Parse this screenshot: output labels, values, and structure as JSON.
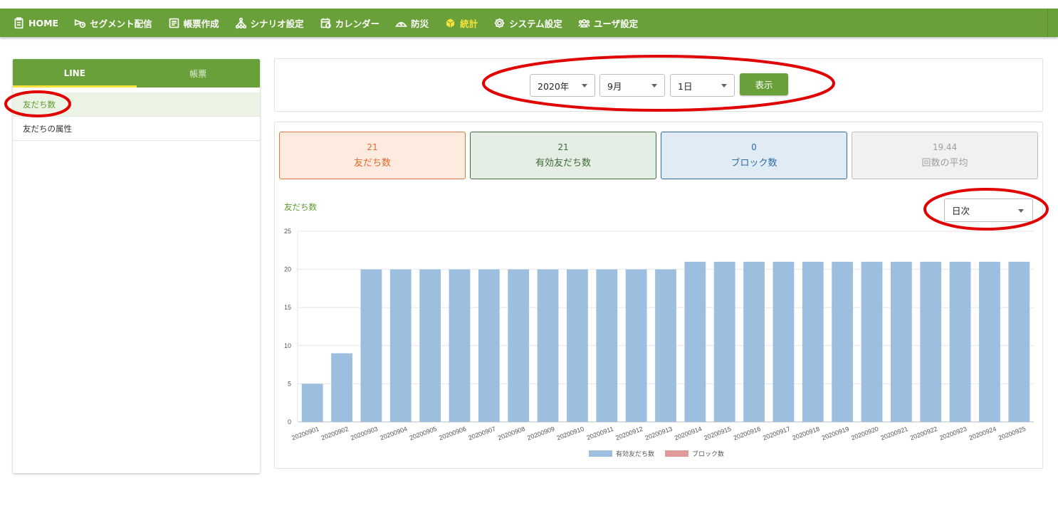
{
  "nav": {
    "items": [
      {
        "label": "HOME",
        "icon": "clipboard-icon"
      },
      {
        "label": "セグメント配信",
        "icon": "send-clock-icon"
      },
      {
        "label": "帳票作成",
        "icon": "form-icon"
      },
      {
        "label": "シナリオ設定",
        "icon": "scenario-icon"
      },
      {
        "label": "カレンダー",
        "icon": "calendar-icon"
      },
      {
        "label": "防災",
        "icon": "disaster-icon"
      },
      {
        "label": "統計",
        "icon": "cube-icon",
        "active": true
      },
      {
        "label": "システム設定",
        "icon": "gear-icon"
      },
      {
        "label": "ユーザ設定",
        "icon": "users-icon"
      }
    ],
    "accent": "#6aa03a",
    "active_color": "#f6e23a"
  },
  "sidebar": {
    "tabs": [
      {
        "label": "LINE"
      },
      {
        "label": "帳票"
      }
    ],
    "items": [
      {
        "label": "友だち数"
      },
      {
        "label": "友だちの属性"
      }
    ]
  },
  "filters": {
    "year": "2020年",
    "month": "9月",
    "day": "1日",
    "show_button": "表示"
  },
  "stats": [
    {
      "value": "21",
      "label": "友だち数"
    },
    {
      "value": "21",
      "label": "有効友だち数"
    },
    {
      "value": "0",
      "label": "ブロック数"
    },
    {
      "value": "19.44",
      "label": "回数の平均"
    }
  ],
  "chart_header": {
    "title": "友だち数",
    "period": "日次"
  },
  "chart_data": {
    "type": "bar",
    "categories": [
      "20200901",
      "20200902",
      "20200903",
      "20200904",
      "20200905",
      "20200906",
      "20200907",
      "20200908",
      "20200909",
      "20200910",
      "20200911",
      "20200912",
      "20200913",
      "20200914",
      "20200915",
      "20200916",
      "20200917",
      "20200918",
      "20200919",
      "20200920",
      "20200921",
      "20200922",
      "20200923",
      "20200924",
      "20200925"
    ],
    "series": [
      {
        "name": "有効友だち数",
        "color": "#9dbfdf",
        "values": [
          5,
          9,
          20,
          20,
          20,
          20,
          20,
          20,
          20,
          20,
          20,
          20,
          20,
          21,
          21,
          21,
          21,
          21,
          21,
          21,
          21,
          21,
          21,
          21,
          21
        ]
      },
      {
        "name": "ブロック数",
        "color": "#e09a9a",
        "values": [
          0,
          0,
          0,
          0,
          0,
          0,
          0,
          0,
          0,
          0,
          0,
          0,
          0,
          0,
          0,
          0,
          0,
          0,
          0,
          0,
          0,
          0,
          0,
          0,
          0
        ]
      }
    ],
    "yticks": [
      0,
      5,
      10,
      15,
      20,
      25
    ],
    "ylim": [
      0,
      25
    ],
    "grid": true,
    "legend_position": "bottom"
  }
}
